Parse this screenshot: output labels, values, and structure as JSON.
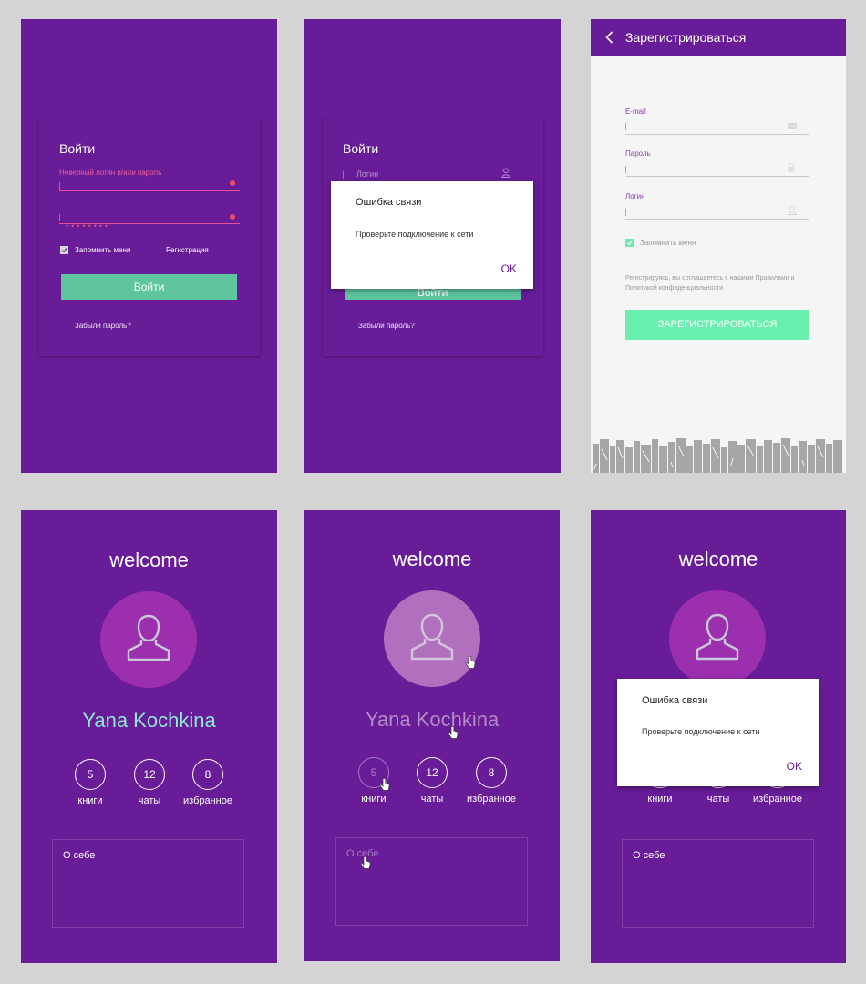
{
  "login": {
    "title": "Войти",
    "error": "Неверный логин и/или пароль",
    "password_mask": "••••••••",
    "remember": "Запомнить меня",
    "register_link": "Регистрация",
    "submit": "Войти",
    "forgot": "Забыли пароль?"
  },
  "login_error": {
    "title": "Войти",
    "login_placeholder": "Логин",
    "submit": "Войти",
    "forgot": "Забыли пароль?",
    "dialog": {
      "title": "Ошибка связи",
      "text": "Проверьте подключение к сети",
      "ok": "OK"
    }
  },
  "register": {
    "title": "Зарегистрироваться",
    "email_label": "E-mail",
    "password_label": "Пароль",
    "login_label": "Логин",
    "remember": "Запомнить меня",
    "terms": "Регистрируясь, вы соглашаетесь с нашими Правилами и Политикой конфиденциальности",
    "submit": "ЗАРЕГИСТРИРОВАТЬСЯ"
  },
  "profile": {
    "welcome": "welcome",
    "name": "Yana Kochkina",
    "stats": [
      {
        "value": "5",
        "label": "книги"
      },
      {
        "value": "12",
        "label": "чаты"
      },
      {
        "value": "8",
        "label": "избранное"
      }
    ],
    "about": "О себе",
    "dialog": {
      "title": "Ошибка связи",
      "text": "Проверьте подключение к сети",
      "ok": "OK"
    }
  },
  "colors": {
    "primary": "#681c98",
    "accent_green": "#5ec59f",
    "register_green": "#69f0ae",
    "name_teal": "#8de9d6",
    "error_red": "#ef4b6c",
    "avatar": "#9b2fae"
  }
}
